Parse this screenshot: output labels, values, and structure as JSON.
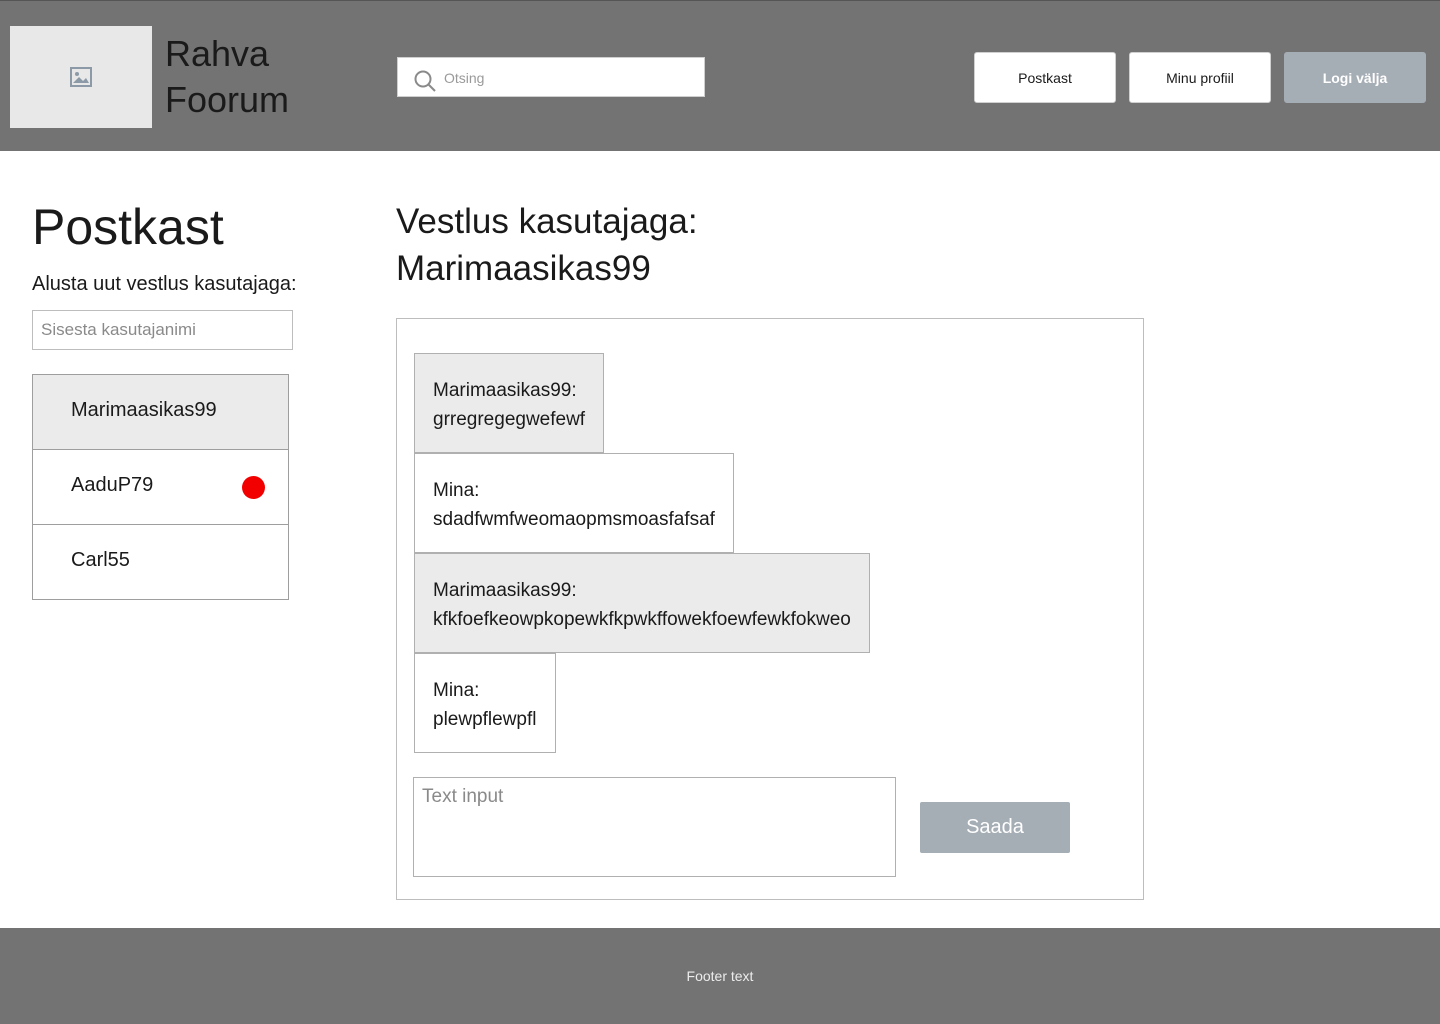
{
  "header": {
    "logo_icon": "image-placeholder-icon",
    "site_title": "Rahva Foorum",
    "search": {
      "placeholder": "Otsing",
      "icon": "search-icon"
    },
    "nav": {
      "inbox_label": "Postkast",
      "profile_label": "Minu profiil",
      "logout_label": "Logi välja"
    }
  },
  "sidebar": {
    "title": "Postkast",
    "new_conversation_label": "Alusta uut vestlus kasutajaga:",
    "username_placeholder": "Sisesta kasutajanimi",
    "conversations": [
      {
        "name": "Marimaasikas99",
        "active": true,
        "unread": false
      },
      {
        "name": "AaduP79",
        "active": false,
        "unread": true
      },
      {
        "name": "Carl55",
        "active": false,
        "unread": false
      }
    ]
  },
  "chat": {
    "title": "Vestlus kasutajaga: Marimaasikas99",
    "messages": [
      {
        "sender": "Marimaasikas99:",
        "text": "grregregegwefewf",
        "own": false
      },
      {
        "sender": "Mina:",
        "text": "sdadfwmfweomaopmsmoasfafsaf",
        "own": true
      },
      {
        "sender": "Marimaasikas99:",
        "text": "kfkfoefkeowpkopewkfkpwkffowekfoewfewkfokweo",
        "own": false
      },
      {
        "sender": "Mina:",
        "text": "plewpflewpfl",
        "own": true
      }
    ],
    "input_placeholder": "Text input",
    "send_label": "Saada"
  },
  "footer": {
    "text": "Footer text"
  },
  "colors": {
    "header_bg": "#737373",
    "button_primary": "#a5adb5",
    "unread_dot": "#f20000",
    "selected_bg": "#ebebeb"
  }
}
